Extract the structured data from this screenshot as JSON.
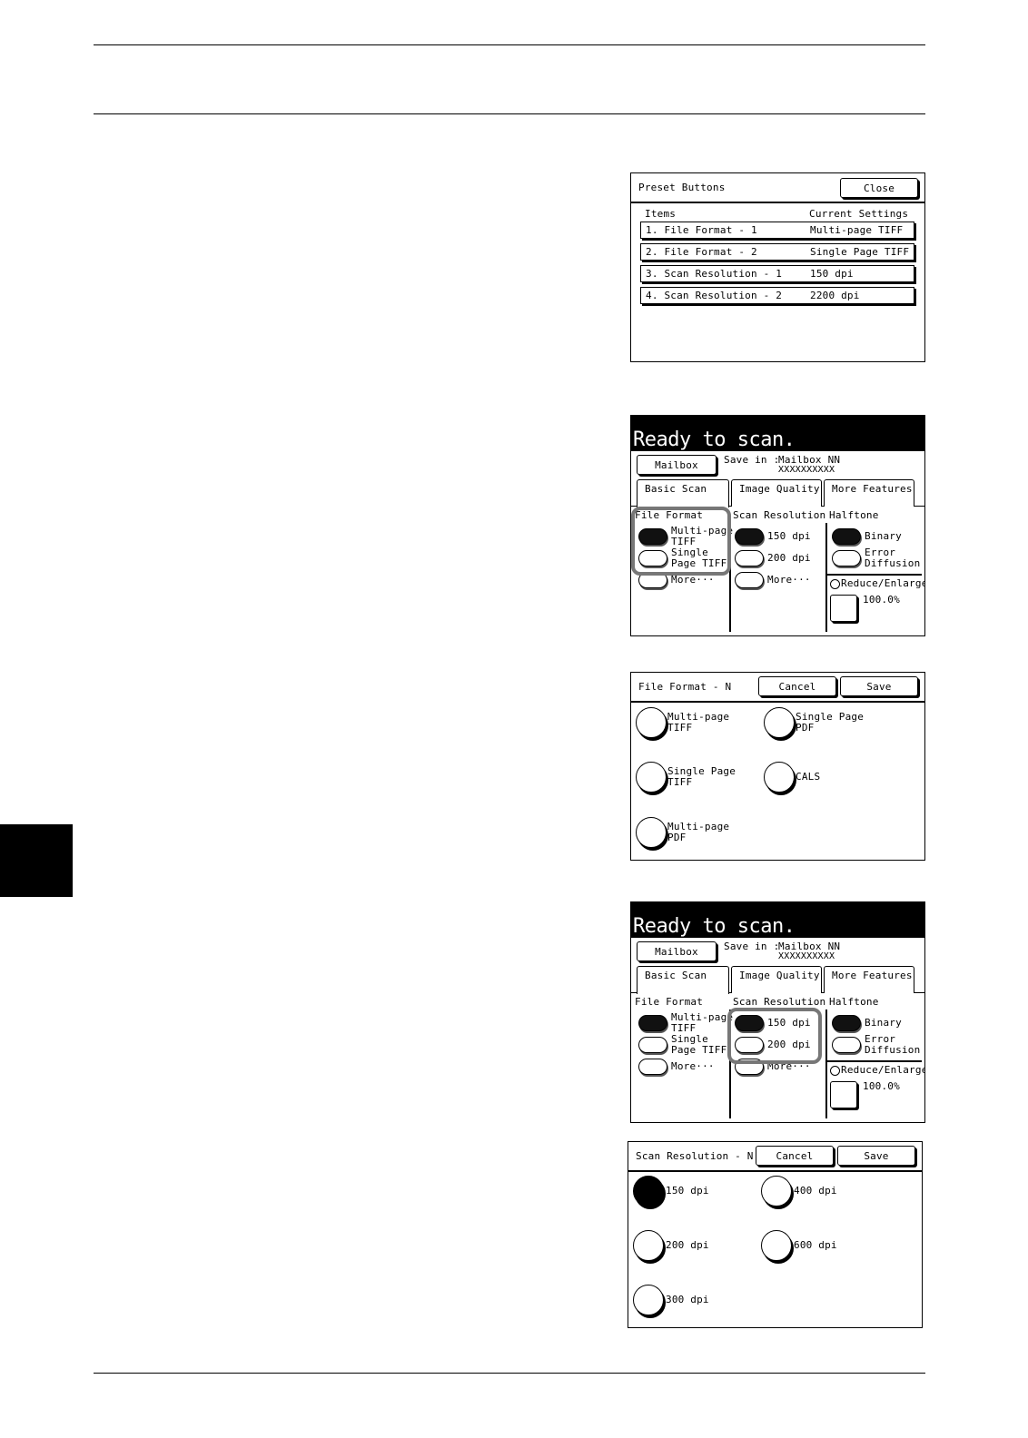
{
  "layout_marks": {},
  "preset": {
    "title": "Preset Buttons",
    "close_label": "Close",
    "col_items": "Items",
    "col_current": "Current Settings",
    "rows": [
      {
        "item": "1. File Format - 1",
        "value": "Multi-page TIFF"
      },
      {
        "item": "2. File Format - 2",
        "value": "Single Page TIFF"
      },
      {
        "item": "3. Scan Resolution - 1",
        "value": "150 dpi"
      },
      {
        "item": "4. Scan Resolution - 2",
        "value": "2200 dpi"
      }
    ]
  },
  "scan": {
    "title": "Ready to scan.",
    "mailbox_label": "Mailbox",
    "save_in_label": "Save in :",
    "save_in_value": "Mailbox NN",
    "save_in_id": "XXXXXXXXXX",
    "tabs": [
      "Basic Scan",
      "Image Quality",
      "More Features"
    ],
    "file_format_title": "File Format",
    "file_format_options": [
      "Multi-page TIFF",
      "Single Page TIFF",
      "More..."
    ],
    "ff_opt1_l1": "Multi-page",
    "ff_opt1_l2": "TIFF",
    "ff_opt2_l1": "Single",
    "ff_opt2_l2": "Page TIFF",
    "ff_more": "More···",
    "resolution_title": "Scan Resolution",
    "res_opt1": "150 dpi",
    "res_opt2": "200 dpi",
    "res_more": "More···",
    "halftone_title": "Halftone",
    "ht_opt1": "Binary",
    "ht_opt2_l1": "Error",
    "ht_opt2_l2": "Diffusion",
    "reduce_label": "Reduce/Enlarge",
    "reduce_value": "100.0%"
  },
  "file_format_dialog": {
    "title": "File Format - N",
    "cancel_label": "Cancel",
    "save_label": "Save",
    "opt1_l1": "Multi-page",
    "opt1_l2": "TIFF",
    "opt2_l1": "Single Page",
    "opt2_l2": "PDF",
    "opt3_l1": "Single Page",
    "opt3_l2": "TIFF",
    "opt4": "CALS",
    "opt5_l1": "Multi-page",
    "opt5_l2": "PDF"
  },
  "resolution_dialog": {
    "title": "Scan Resolution - N",
    "cancel_label": "Cancel",
    "save_label": "Save",
    "options": [
      "150 dpi",
      "400 dpi",
      "200 dpi",
      "600 dpi",
      "300 dpi"
    ],
    "selected": "150 dpi"
  }
}
